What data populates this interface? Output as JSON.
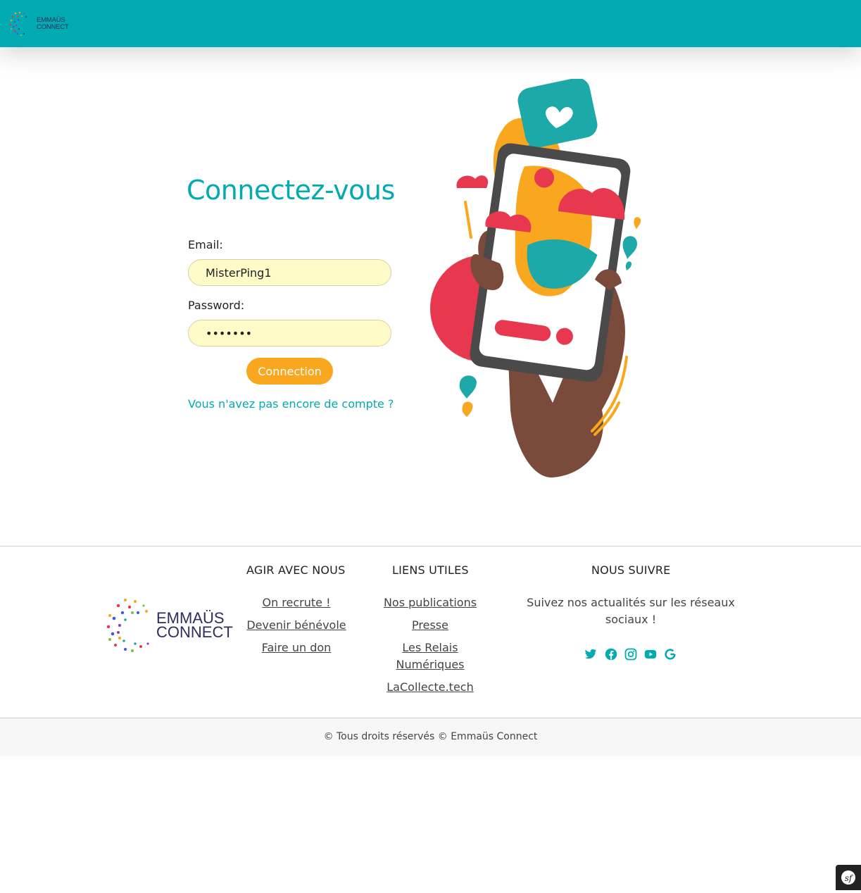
{
  "brand": {
    "logo_line1": "EMMAÜS",
    "logo_line2": "CONNECT",
    "colors": {
      "teal": "#02aab2",
      "orange": "#f9a71e",
      "input_bg": "#fffbc8",
      "red": "#e8384f",
      "skin": "#7a4a3a"
    }
  },
  "login": {
    "title": "Connectez-vous",
    "email_label": "Email:",
    "email_value": "MisterPing1",
    "password_label": "Password:",
    "password_value": "•••••••",
    "submit_label": "Connection",
    "signup_link": "Vous n'avez pas encore de compte ?"
  },
  "footer": {
    "col_agir": {
      "heading": "AGIR AVEC NOUS",
      "links": [
        "On recrute !",
        "Devenir bénévole",
        "Faire un don"
      ]
    },
    "col_liens": {
      "heading": "LIENS UTILES",
      "links": [
        "Nos publications",
        "Presse",
        "Les Relais Numériques",
        "LaCollecte.tech"
      ]
    },
    "col_suivre": {
      "heading": "NOUS SUIVRE",
      "text": "Suivez nos actualités sur les réseaux sociaux !",
      "icons": [
        "twitter-icon",
        "facebook-icon",
        "instagram-icon",
        "youtube-icon",
        "google-icon"
      ]
    }
  },
  "copyright": "© Tous droits réservés © Emmaüs Connect",
  "debug_badge": "sf"
}
